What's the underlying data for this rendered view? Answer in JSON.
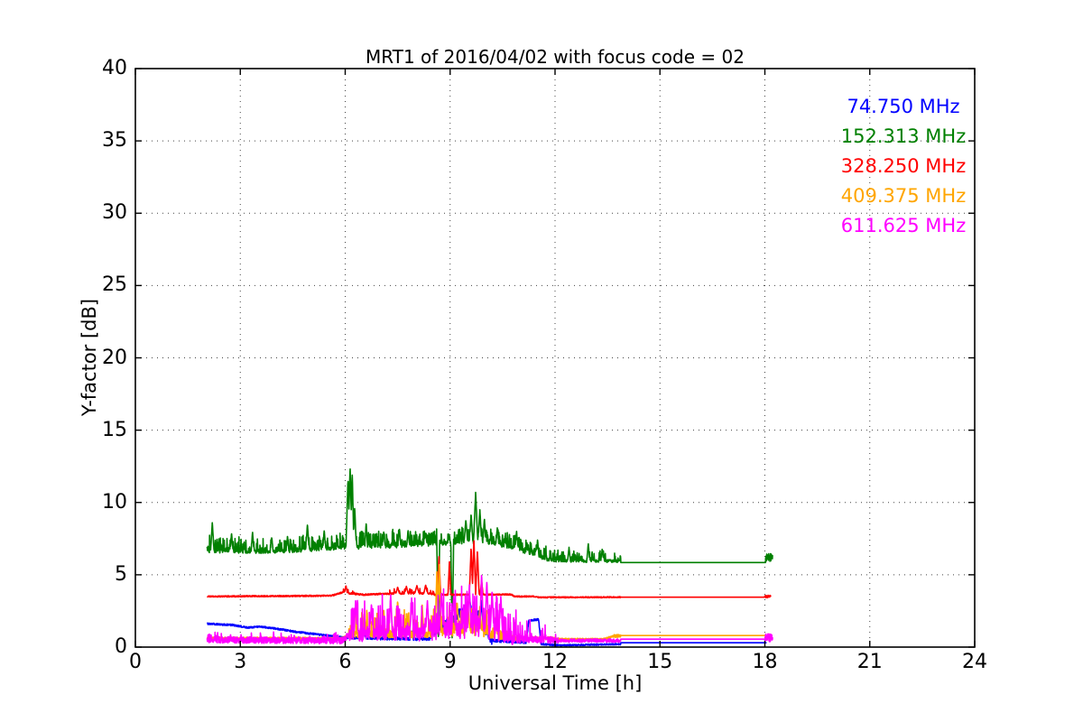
{
  "chart_data": {
    "type": "line",
    "title": "MRT1 of 2016/04/02 with focus code = 02",
    "xlabel": "Universal Time [h]",
    "ylabel": "Y-factor [dB]",
    "xlim": [
      0,
      24
    ],
    "ylim": [
      0,
      40
    ],
    "xticks": [
      0,
      3,
      6,
      9,
      12,
      15,
      18,
      21,
      24
    ],
    "yticks": [
      0,
      5,
      10,
      15,
      20,
      25,
      30,
      35,
      40
    ],
    "grid": "dotted black at every major tick",
    "legend": {
      "position": "upper right",
      "frame": false,
      "text_only": true
    },
    "profile_format": "[time_h, base_dB, noise_amp_dB, spike_probability, spike_amp_dB]",
    "spike_format": "[time_h, peak_dB, half_width_h]",
    "flat_format": "constant value segment after noisy data ends",
    "series": [
      {
        "label": "74.750 MHz",
        "color": "#0000ff",
        "profile": [
          [
            2.05,
            1.62,
            0.06,
            0,
            0
          ],
          [
            2.8,
            1.52,
            0.06,
            0,
            0
          ],
          [
            3.2,
            1.35,
            0.06,
            0,
            0
          ],
          [
            3.55,
            1.42,
            0.06,
            0,
            0
          ],
          [
            4.1,
            1.25,
            0.06,
            0,
            0
          ],
          [
            4.6,
            1.05,
            0.06,
            0,
            0
          ],
          [
            5.3,
            0.85,
            0.06,
            0,
            0
          ],
          [
            6.0,
            0.65,
            0.08,
            0,
            0
          ],
          [
            7.0,
            0.6,
            0.1,
            0.03,
            0.4
          ],
          [
            8.4,
            0.55,
            0.12,
            0.03,
            0.4
          ],
          [
            8.75,
            1.4,
            0.3,
            0,
            0
          ],
          [
            9.0,
            1.8,
            0.35,
            0,
            0
          ],
          [
            9.25,
            2.3,
            0.35,
            0,
            0
          ],
          [
            9.5,
            2.8,
            0.3,
            0,
            0
          ],
          [
            9.6,
            2.6,
            0.3,
            0,
            0
          ],
          [
            9.8,
            2.2,
            0.35,
            0,
            0
          ],
          [
            10.0,
            1.2,
            0.3,
            0,
            0
          ],
          [
            10.2,
            0.45,
            0.1,
            0,
            0
          ],
          [
            11.18,
            0.35,
            0.08,
            0,
            0
          ],
          [
            11.25,
            1.85,
            0.07,
            0,
            0
          ],
          [
            11.53,
            1.9,
            0.07,
            0,
            0
          ],
          [
            11.6,
            0.2,
            0.06,
            0,
            0
          ],
          [
            12.1,
            0.12,
            0.05,
            0,
            0
          ],
          [
            13.88,
            0.2,
            0.06,
            0,
            0
          ]
        ],
        "spikes": [
          [
            9.55,
            3.4,
            0.05
          ],
          [
            9.9,
            3.3,
            0.04
          ],
          [
            6.55,
            1.0,
            0.04
          ],
          [
            7.9,
            1.1,
            0.05
          ]
        ],
        "flat": {
          "t0": 13.88,
          "t1": 18.05,
          "value": 0.3
        },
        "endblob": null
      },
      {
        "label": "152.313 MHz",
        "color": "#008000",
        "profile": [
          [
            2.05,
            6.65,
            0.12,
            0.3,
            1.0
          ],
          [
            3.0,
            6.55,
            0.12,
            0.3,
            0.9
          ],
          [
            4.6,
            6.65,
            0.12,
            0.3,
            1.0
          ],
          [
            5.85,
            6.85,
            0.12,
            0.32,
            1.0
          ],
          [
            6.45,
            6.9,
            0.13,
            0.35,
            1.1
          ],
          [
            7.6,
            7.0,
            0.15,
            0.35,
            0.9
          ],
          [
            9.25,
            7.25,
            0.18,
            0.35,
            0.9
          ],
          [
            10.0,
            7.35,
            0.18,
            0.35,
            0.9
          ],
          [
            10.6,
            7.0,
            0.15,
            0.35,
            0.9
          ],
          [
            11.25,
            6.55,
            0.14,
            0.3,
            0.8
          ],
          [
            11.8,
            6.05,
            0.12,
            0.25,
            0.7
          ],
          [
            12.3,
            5.95,
            0.1,
            0.2,
            0.7
          ],
          [
            13.88,
            5.95,
            0.1,
            0.2,
            0.7
          ]
        ],
        "spikes": [
          [
            2.2,
            8.6,
            0.05
          ],
          [
            2.75,
            7.9,
            0.04
          ],
          [
            3.35,
            8.0,
            0.04
          ],
          [
            3.9,
            7.6,
            0.04
          ],
          [
            4.35,
            7.7,
            0.04
          ],
          [
            4.92,
            8.5,
            0.05
          ],
          [
            5.4,
            8.1,
            0.04
          ],
          [
            6.08,
            11.6,
            0.06
          ],
          [
            6.14,
            12.5,
            0.06
          ],
          [
            6.2,
            12.1,
            0.05
          ],
          [
            6.27,
            9.7,
            0.05
          ],
          [
            6.6,
            8.6,
            0.04
          ],
          [
            7.1,
            8.0,
            0.04
          ],
          [
            7.55,
            8.2,
            0.04
          ],
          [
            7.8,
            8.1,
            0.04
          ],
          [
            8.3,
            7.9,
            0.04
          ],
          [
            8.66,
            0.4,
            0.04
          ],
          [
            9.06,
            0.3,
            0.04
          ],
          [
            9.45,
            8.8,
            0.05
          ],
          [
            9.6,
            9.2,
            0.05
          ],
          [
            9.73,
            10.7,
            0.06
          ],
          [
            9.85,
            9.5,
            0.05
          ],
          [
            9.98,
            8.9,
            0.04
          ],
          [
            10.35,
            8.3,
            0.04
          ],
          [
            10.9,
            8.0,
            0.04
          ],
          [
            11.5,
            7.4,
            0.04
          ],
          [
            12.4,
            6.9,
            0.04
          ],
          [
            12.95,
            7.2,
            0.04
          ],
          [
            13.35,
            6.8,
            0.04
          ]
        ],
        "flat": {
          "t0": 13.88,
          "t1": 18.02,
          "value": 5.85
        },
        "endblob": {
          "t0": 18.02,
          "t1": 18.22,
          "base": 6.2,
          "noise": 0.28
        }
      },
      {
        "label": "328.250 MHz",
        "color": "#ff0000",
        "profile": [
          [
            2.05,
            3.5,
            0.045,
            0,
            0
          ],
          [
            5.6,
            3.55,
            0.045,
            0,
            0
          ],
          [
            5.95,
            3.8,
            0.07,
            0.1,
            0.3
          ],
          [
            6.15,
            3.72,
            0.06,
            0.1,
            0.2
          ],
          [
            6.5,
            3.62,
            0.05,
            0,
            0
          ],
          [
            7.25,
            3.7,
            0.06,
            0.15,
            0.35
          ],
          [
            8.35,
            3.72,
            0.06,
            0.15,
            0.35
          ],
          [
            8.55,
            3.62,
            0.05,
            0,
            0
          ],
          [
            10.75,
            3.64,
            0.05,
            0,
            0
          ],
          [
            10.85,
            3.5,
            0.045,
            0,
            0
          ],
          [
            11.4,
            3.5,
            0.045,
            0,
            0
          ],
          [
            11.55,
            3.44,
            0.04,
            0,
            0
          ],
          [
            13.88,
            3.45,
            0.04,
            0,
            0
          ]
        ],
        "spikes": [
          [
            6.02,
            4.25,
            0.04
          ],
          [
            7.5,
            4.15,
            0.05
          ],
          [
            7.75,
            4.2,
            0.05
          ],
          [
            8.05,
            4.25,
            0.06
          ],
          [
            8.3,
            4.3,
            0.05
          ],
          [
            8.68,
            6.25,
            0.05
          ],
          [
            8.98,
            5.9,
            0.04
          ],
          [
            9.6,
            6.9,
            0.05
          ],
          [
            9.68,
            7.5,
            0.05
          ],
          [
            9.78,
            6.7,
            0.05
          ],
          [
            9.9,
            4.6,
            0.04
          ]
        ],
        "flat": {
          "t0": 13.88,
          "t1": 18.05,
          "value": 3.45
        },
        "endblob": {
          "t0": 18.0,
          "t1": 18.17,
          "base": 3.5,
          "noise": 0.09
        }
      },
      {
        "label": "409.375 MHz",
        "color": "#ffa500",
        "profile": [
          [
            2.05,
            0.62,
            0.07,
            0,
            0
          ],
          [
            5.9,
            0.6,
            0.07,
            0,
            0
          ],
          [
            6.1,
            0.85,
            0.25,
            0.12,
            1.6
          ],
          [
            8.5,
            0.9,
            0.3,
            0.12,
            1.8
          ],
          [
            9.0,
            1.2,
            0.45,
            0.15,
            1.6
          ],
          [
            9.6,
            1.3,
            0.5,
            0.15,
            1.5
          ],
          [
            10.1,
            1.0,
            0.35,
            0.12,
            1.2
          ],
          [
            10.6,
            0.7,
            0.15,
            0.05,
            0.6
          ],
          [
            11.0,
            0.6,
            0.1,
            0,
            0
          ],
          [
            11.9,
            0.62,
            0.1,
            0,
            0
          ],
          [
            12.05,
            0.55,
            0.06,
            0,
            0
          ],
          [
            13.4,
            0.55,
            0.06,
            0,
            0
          ],
          [
            13.65,
            0.75,
            0.1,
            0,
            0
          ],
          [
            13.88,
            0.8,
            0.08,
            0,
            0
          ]
        ],
        "spikes": [
          [
            6.55,
            2.2,
            0.05
          ],
          [
            7.1,
            2.6,
            0.05
          ],
          [
            7.5,
            3.2,
            0.05
          ],
          [
            7.8,
            2.4,
            0.04
          ],
          [
            8.2,
            2.9,
            0.05
          ],
          [
            8.62,
            5.2,
            0.05
          ],
          [
            8.69,
            5.9,
            0.05
          ],
          [
            9.2,
            3.1,
            0.05
          ],
          [
            9.5,
            3.2,
            0.06
          ],
          [
            9.85,
            2.8,
            0.05
          ],
          [
            10.3,
            2.1,
            0.05
          ]
        ],
        "flat": {
          "t0": 13.88,
          "t1": 18.05,
          "value": 0.8
        },
        "endblob": null
      },
      {
        "label": "611.625 MHz",
        "color": "#ff00ff",
        "profile": [
          [
            2.05,
            0.5,
            0.22,
            0.05,
            0.5
          ],
          [
            5.9,
            0.45,
            0.2,
            0.05,
            0.4
          ],
          [
            6.1,
            0.8,
            0.45,
            0.15,
            2.2
          ],
          [
            7.0,
            0.9,
            0.5,
            0.18,
            2.4
          ],
          [
            8.0,
            1.0,
            0.6,
            0.2,
            2.6
          ],
          [
            9.3,
            1.2,
            0.7,
            0.2,
            2.4
          ],
          [
            10.0,
            1.3,
            0.7,
            0.2,
            2.6
          ],
          [
            10.55,
            0.9,
            0.5,
            0.15,
            1.8
          ],
          [
            10.9,
            0.55,
            0.25,
            0.05,
            1.2
          ],
          [
            11.9,
            0.5,
            0.2,
            0.04,
            0.5
          ],
          [
            12.1,
            0.45,
            0.12,
            0,
            0
          ],
          [
            13.88,
            0.45,
            0.12,
            0,
            0
          ]
        ],
        "spikes": [
          [
            6.3,
            3.3,
            0.05
          ],
          [
            6.75,
            3.0,
            0.05
          ],
          [
            7.3,
            3.6,
            0.05
          ],
          [
            7.9,
            3.4,
            0.05
          ],
          [
            8.35,
            3.2,
            0.05
          ],
          [
            8.75,
            3.8,
            0.06
          ],
          [
            9.1,
            3.5,
            0.05
          ],
          [
            9.55,
            4.3,
            0.05
          ],
          [
            9.9,
            5.1,
            0.05
          ],
          [
            10.05,
            4.6,
            0.05
          ],
          [
            10.2,
            3.9,
            0.05
          ],
          [
            10.45,
            3.5,
            0.05
          ]
        ],
        "flat": {
          "t0": 13.88,
          "t1": 18.02,
          "value": 0.55
        },
        "endblob": {
          "t0": 18.0,
          "t1": 18.22,
          "base": 0.65,
          "noise": 0.28
        }
      }
    ]
  }
}
